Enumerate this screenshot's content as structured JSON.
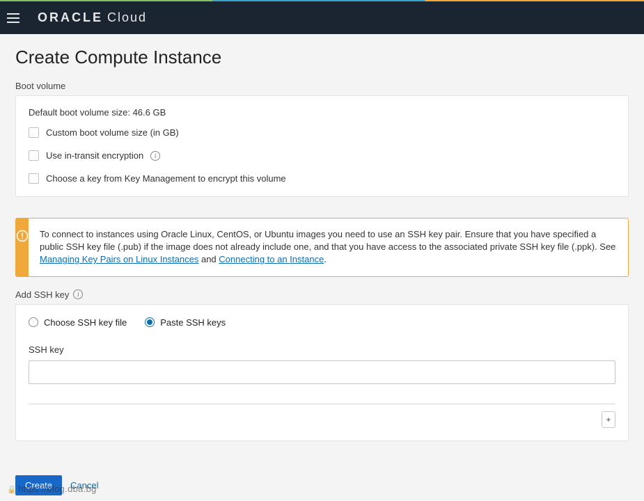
{
  "brand": {
    "bold": "ORACLE",
    "light": "Cloud"
  },
  "page": {
    "title": "Create Compute Instance"
  },
  "boot": {
    "section_label": "Boot volume",
    "default_size_text": "Default boot volume size: 46.6 GB",
    "custom_size_label": "Custom boot volume size (in GB)",
    "in_transit_label": "Use in-transit encryption",
    "key_mgmt_label": "Choose a key from Key Management to encrypt this volume"
  },
  "alert": {
    "text_before_link1": "To connect to instances using Oracle Linux, CentOS, or Ubuntu images you need to use an SSH key pair. Ensure that you have specified a public SSH key file (.pub) if the image does not already include one, and that you have access to the associated private SSH key file (.ppk). See ",
    "link1": "Managing Key Pairs on Linux Instances",
    "middle": " and ",
    "link2": "Connecting to an Instance",
    "end": "."
  },
  "ssh": {
    "section_label": "Add SSH key",
    "radio_choose_file": "Choose SSH key file",
    "radio_paste": "Paste SSH keys",
    "field_label": "SSH key",
    "input_value": "",
    "add_btn": "+"
  },
  "footer": {
    "create": "Create",
    "cancel": "Cancel"
  },
  "watermark": "https://blog.dba.bg"
}
